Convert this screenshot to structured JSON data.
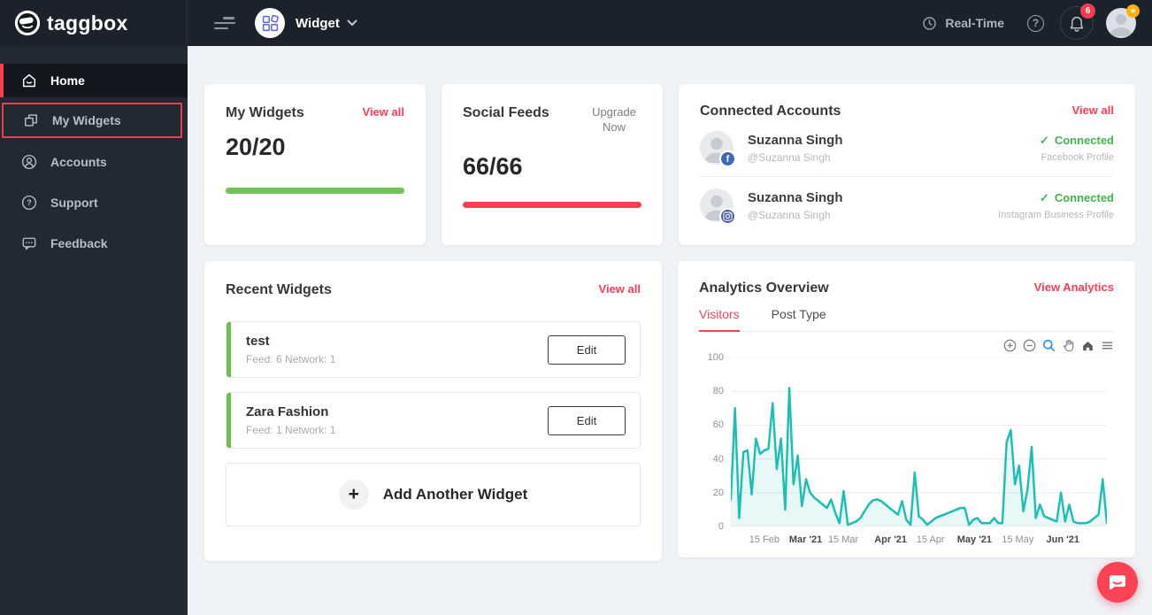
{
  "brand": {
    "name": "taggbox"
  },
  "topbar": {
    "context_label": "Widget",
    "realtime_label": "Real-Time",
    "notification_badge": "6"
  },
  "sidebar": {
    "items": [
      {
        "label": "Home",
        "icon": "home-icon",
        "state": "active"
      },
      {
        "label": "My Widgets",
        "icon": "widgets-icon",
        "state": "highlighted"
      },
      {
        "label": "Accounts",
        "icon": "user-icon",
        "state": "default"
      },
      {
        "label": "Support",
        "icon": "question-icon",
        "state": "default"
      },
      {
        "label": "Feedback",
        "icon": "feedback-icon",
        "state": "default"
      }
    ]
  },
  "cards": {
    "my_widgets": {
      "title": "My Widgets",
      "action": "View all",
      "count": "20/20",
      "bar_color": "#72c356"
    },
    "social_feeds": {
      "title": "Social Feeds",
      "action": "Upgrade Now",
      "count": "66/66",
      "bar_color": "#fb3e50"
    },
    "connected_accounts": {
      "title": "Connected Accounts",
      "action": "View all",
      "accounts": [
        {
          "name": "Suzanna Singh",
          "handle": "@Suzanna Singh",
          "network": "facebook",
          "status": "Connected",
          "profile_type": "Facebook Profile"
        },
        {
          "name": "Suzanna Singh",
          "handle": "@Suzanna Singh",
          "network": "instagram",
          "status": "Connected",
          "profile_type": "Instagram Business Profile"
        }
      ]
    },
    "recent_widgets": {
      "title": "Recent Widgets",
      "action": "View all",
      "widgets": [
        {
          "name": "test",
          "meta": "Feed: 6 Network: 1",
          "button": "Edit"
        },
        {
          "name": "Zara Fashion",
          "meta": "Feed: 1 Network: 1",
          "button": "Edit"
        }
      ],
      "add_label": "Add Another Widget"
    },
    "analytics": {
      "title": "Analytics Overview",
      "action": "View Analytics",
      "tabs": [
        {
          "label": "Visitors",
          "active": true
        },
        {
          "label": "Post Type",
          "active": false
        }
      ]
    }
  },
  "chart_data": {
    "type": "area",
    "title": "Visitors",
    "xlabel": "",
    "ylabel": "",
    "ylim": [
      0,
      100
    ],
    "grid": true,
    "legend": "none",
    "line_color": "#1dbfb4",
    "fill_color": "rgba(29,191,180,0.10)",
    "y_ticks": [
      0,
      20,
      40,
      60,
      80,
      100
    ],
    "x_ticks": [
      {
        "label": "15 Feb",
        "frac": 0.089,
        "bold": false
      },
      {
        "label": "Mar '21",
        "frac": 0.199,
        "bold": true
      },
      {
        "label": "15 Mar",
        "frac": 0.299,
        "bold": false
      },
      {
        "label": "Apr '21",
        "frac": 0.425,
        "bold": true
      },
      {
        "label": "15 Apr",
        "frac": 0.531,
        "bold": false
      },
      {
        "label": "May '21",
        "frac": 0.648,
        "bold": true
      },
      {
        "label": "15 May",
        "frac": 0.763,
        "bold": false
      },
      {
        "label": "Jun '21",
        "frac": 0.883,
        "bold": true
      }
    ],
    "values": [
      16,
      70,
      5,
      44,
      45,
      19,
      52,
      43,
      45,
      46,
      73,
      34,
      52,
      10,
      82,
      25,
      42,
      12,
      28,
      20,
      17,
      15,
      13,
      11,
      16,
      8,
      2,
      21,
      1,
      2,
      3,
      5,
      9,
      13,
      15.5,
      16,
      15,
      13,
      11,
      9,
      7,
      15,
      4,
      1,
      32,
      6,
      4,
      1,
      3,
      5,
      6,
      7,
      8,
      9,
      10,
      11,
      11,
      1,
      4,
      5,
      2,
      2,
      2,
      5,
      2,
      2,
      50,
      57,
      25,
      36,
      9,
      22,
      47,
      5,
      13,
      6,
      5,
      4,
      3,
      20,
      3,
      13,
      3,
      2,
      2,
      2,
      3,
      5,
      7,
      28,
      2
    ]
  },
  "icons": {
    "check": "✓",
    "star": "★",
    "plus": "+",
    "question": "?",
    "facebook_glyph": "f"
  },
  "colors": {
    "accent_red": "#fc3d55",
    "sidebar_bg": "#232933",
    "topbar_bg": "#1c222c",
    "progress_green": "#72c356",
    "progress_red": "#fb3e50",
    "connected_green": "#41b64e",
    "chart_line": "#1dbfb4"
  }
}
